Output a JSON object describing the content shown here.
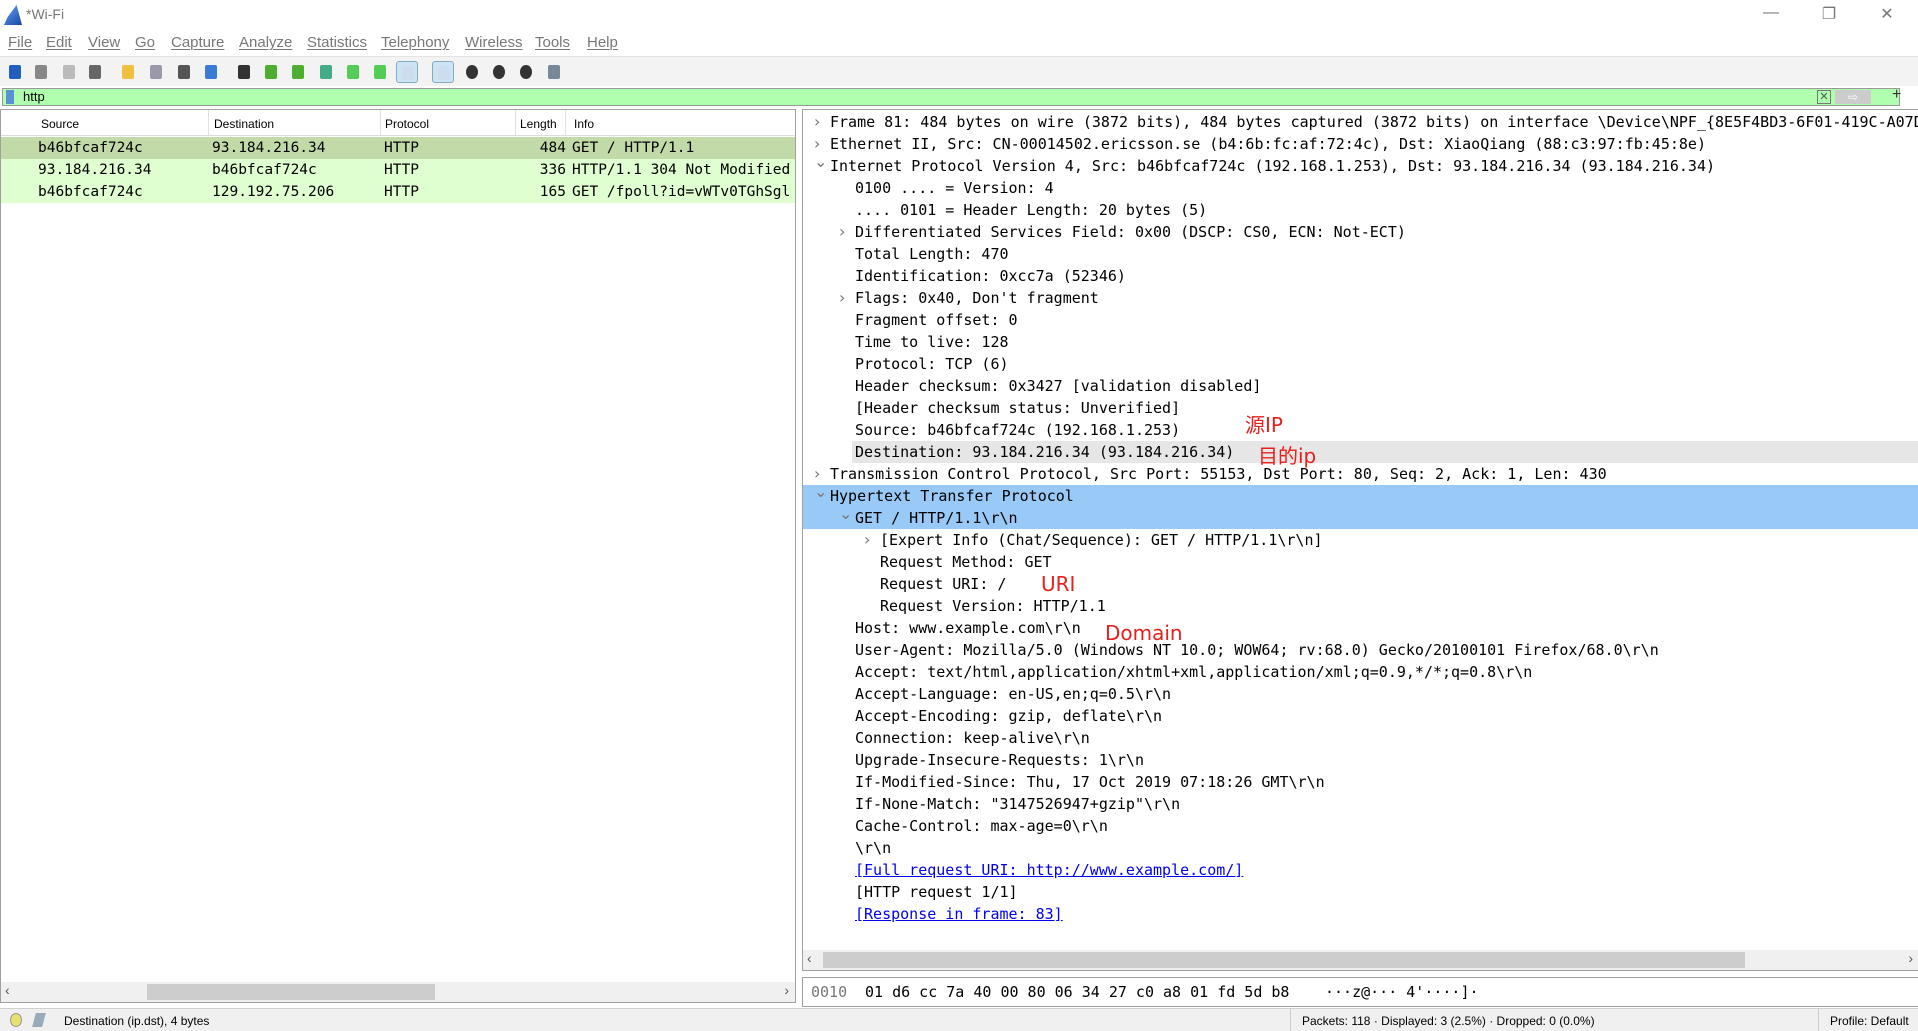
{
  "window": {
    "title": "*Wi-Fi",
    "minimize": "—",
    "restore": "❐",
    "close": "✕"
  },
  "menu": [
    "File",
    "Edit",
    "View",
    "Go",
    "Capture",
    "Analyze",
    "Statistics",
    "Telephony",
    "Wireless",
    "Tools",
    "Help"
  ],
  "toolbar": [
    "start-capture",
    "stop-capture",
    "restart-capture",
    "capture-options",
    "open-file",
    "save-file",
    "close-file",
    "reload-file",
    "find-packet",
    "go-back",
    "go-forward",
    "go-to-packet",
    "first-packet",
    "last-packet",
    "auto-scroll",
    "colorize",
    "zoom-in",
    "zoom-out",
    "normal-size",
    "resize-columns"
  ],
  "filter": {
    "value": "http",
    "clear": "✕",
    "apply": "⇨",
    "add": "+"
  },
  "packet_list": {
    "columns": [
      "Source",
      "Destination",
      "Protocol",
      "Length",
      "Info"
    ],
    "rows": [
      {
        "source": "b46bfcaf724c",
        "destination": "93.184.216.34",
        "protocol": "HTTP",
        "length": "484",
        "info": "GET / HTTP/1.1",
        "selected": true
      },
      {
        "source": "93.184.216.34",
        "destination": "b46bfcaf724c",
        "protocol": "HTTP",
        "length": "336",
        "info": "HTTP/1.1 304 Not Modified"
      },
      {
        "source": "b46bfcaf724c",
        "destination": "129.192.75.206",
        "protocol": "HTTP",
        "length": "165",
        "info": "GET /fpoll?id=vWTv0TGhSgl"
      }
    ],
    "row_colors": {
      "selected": "#c2daa8",
      "normal": "#e0ffd0"
    }
  },
  "details": [
    {
      "level": 0,
      "expander": ">",
      "text": "Frame 81: 484 bytes on wire (3872 bits), 484 bytes captured (3872 bits) on interface \\Device\\NPF_{8E5F4BD3-6F01-419C-A07D"
    },
    {
      "level": 0,
      "expander": ">",
      "text": "Ethernet II, Src: CN-00014502.ericsson.se (b4:6b:fc:af:72:4c), Dst: XiaoQiang (88:c3:97:fb:45:8e)"
    },
    {
      "level": 0,
      "expander": "v",
      "text": "Internet Protocol Version 4, Src: b46bfcaf724c (192.168.1.253), Dst: 93.184.216.34 (93.184.216.34)"
    },
    {
      "level": 1,
      "text": "0100 .... = Version: 4"
    },
    {
      "level": 1,
      "text": ".... 0101 = Header Length: 20 bytes (5)"
    },
    {
      "level": 1,
      "expander": ">",
      "text": "Differentiated Services Field: 0x00 (DSCP: CS0, ECN: Not-ECT)"
    },
    {
      "level": 1,
      "text": "Total Length: 470"
    },
    {
      "level": 1,
      "text": "Identification: 0xcc7a (52346)"
    },
    {
      "level": 1,
      "expander": ">",
      "text": "Flags: 0x40, Don't fragment"
    },
    {
      "level": 1,
      "text": "Fragment offset: 0"
    },
    {
      "level": 1,
      "text": "Time to live: 128"
    },
    {
      "level": 1,
      "text": "Protocol: TCP (6)"
    },
    {
      "level": 1,
      "text": "Header checksum: 0x3427 [validation disabled]"
    },
    {
      "level": 1,
      "text": "[Header checksum status: Unverified]"
    },
    {
      "level": 1,
      "text": "Source: b46bfcaf724c (192.168.1.253)"
    },
    {
      "level": 1,
      "text": "Destination: 93.184.216.34 (93.184.216.34)",
      "highlight": "grey"
    },
    {
      "level": 0,
      "expander": ">",
      "text": "Transmission Control Protocol, Src Port: 55153, Dst Port: 80, Seq: 2, Ack: 1, Len: 430"
    },
    {
      "level": 0,
      "expander": "v",
      "text": "Hypertext Transfer Protocol",
      "highlight": "blue"
    },
    {
      "level": 1,
      "expander": "v",
      "text": "GET / HTTP/1.1\\r\\n",
      "highlight": "blue"
    },
    {
      "level": 2,
      "expander": ">",
      "text": "[Expert Info (Chat/Sequence): GET / HTTP/1.1\\r\\n]"
    },
    {
      "level": 2,
      "text": "Request Method: GET"
    },
    {
      "level": 2,
      "text": "Request URI: /"
    },
    {
      "level": 2,
      "text": "Request Version: HTTP/1.1"
    },
    {
      "level": 1,
      "text": "Host: www.example.com\\r\\n"
    },
    {
      "level": 1,
      "text": "User-Agent: Mozilla/5.0 (Windows NT 10.0; WOW64; rv:68.0) Gecko/20100101 Firefox/68.0\\r\\n"
    },
    {
      "level": 1,
      "text": "Accept: text/html,application/xhtml+xml,application/xml;q=0.9,*/*;q=0.8\\r\\n"
    },
    {
      "level": 1,
      "text": "Accept-Language: en-US,en;q=0.5\\r\\n"
    },
    {
      "level": 1,
      "text": "Accept-Encoding: gzip, deflate\\r\\n"
    },
    {
      "level": 1,
      "text": "Connection: keep-alive\\r\\n"
    },
    {
      "level": 1,
      "text": "Upgrade-Insecure-Requests: 1\\r\\n"
    },
    {
      "level": 1,
      "text": "If-Modified-Since: Thu, 17 Oct 2019 07:18:26 GMT\\r\\n"
    },
    {
      "level": 1,
      "text": "If-None-Match: \"3147526947+gzip\"\\r\\n"
    },
    {
      "level": 1,
      "text": "Cache-Control: max-age=0\\r\\n"
    },
    {
      "level": 1,
      "text": "\\r\\n"
    },
    {
      "level": 1,
      "text": "[Full request URI: http://www.example.com/]",
      "link": true
    },
    {
      "level": 1,
      "text": "[HTTP request 1/1]"
    },
    {
      "level": 1,
      "text": "[Response in frame: 83]",
      "link": true
    }
  ],
  "annotations": {
    "source_ip": "源IP",
    "dest_ip": "目的ip",
    "uri": "URI",
    "domain": "Domain",
    "color": "#e8201c"
  },
  "hex": {
    "offset": "0010",
    "bytes": "01 d6 cc 7a 40 00 80 06  34 27 c0 a8 01 fd 5d b8",
    "ascii": "···z@··· 4'····]·"
  },
  "status": {
    "field": "Destination (ip.dst), 4 bytes",
    "packets": "Packets: 118 · Displayed: 3 (2.5%) · Dropped: 0 (0.0%)",
    "profile": "Profile: Default"
  }
}
